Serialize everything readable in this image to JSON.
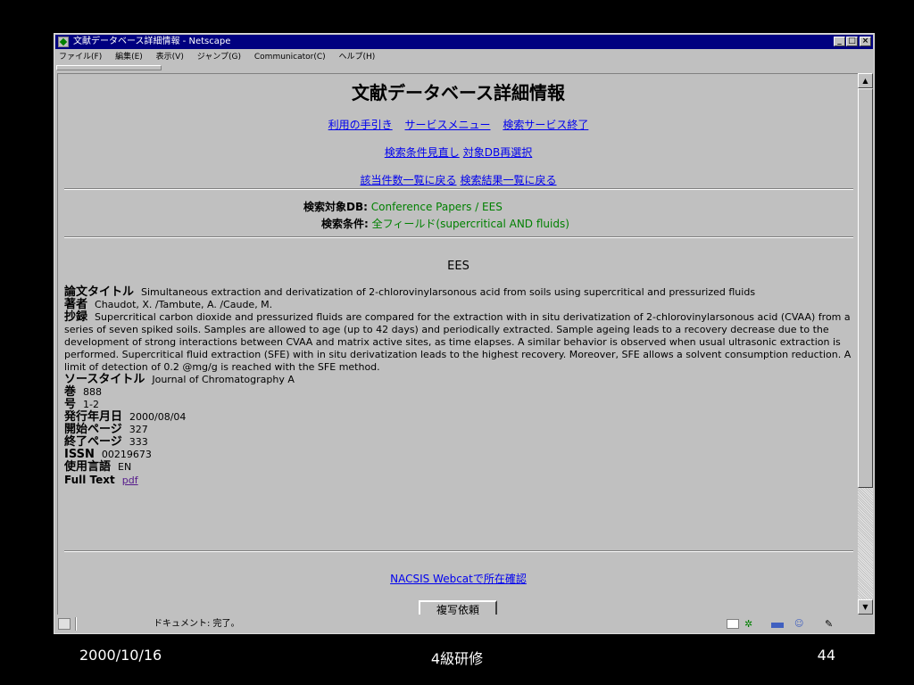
{
  "window": {
    "title": "文献データベース詳細情報 - Netscape",
    "menu": [
      "ファイル(F)",
      "編集(E)",
      "表示(V)",
      "ジャンプ(G)",
      "Communicator(C)",
      "ヘルプ(H)"
    ]
  },
  "page": {
    "title": "文献データベース詳細情報",
    "nav_row1": [
      "利用の手引き",
      "サービスメニュー",
      "検索サービス終了"
    ],
    "nav_row2": [
      "検索条件見直し",
      "対象DB再選択"
    ],
    "nav_row3": [
      "該当件数一覧に戻る",
      "検索結果一覧に戻る"
    ],
    "search": {
      "db_label": "検索対象DB:",
      "db_value": "Conference Papers / EES",
      "cond_label": "検索条件:",
      "cond_value": "全フィールド(supercritical AND fluids)"
    },
    "db_header": "EES",
    "record": {
      "title_label": "論文タイトル",
      "title_value": "Simultaneous extraction and derivatization of 2-chlorovinylarsonous acid from soils using supercritical and pressurized fluids",
      "author_label": "著者",
      "author_value": "Chaudot, X. /Tambute, A. /Caude, M.",
      "abstract_label": "抄録",
      "abstract_value": "Supercritical carbon dioxide and pressurized fluids are compared for the extraction with in situ derivatization of 2-chlorovinylarsonous acid (CVAA) from a series of seven spiked soils. Samples are allowed to age (up to 42 days) and periodically extracted. Sample ageing leads to a recovery decrease due to the development of strong interactions between CVAA and matrix active sites, as time elapses. A similar behavior is observed when usual ultrasonic extraction is performed. Supercritical fluid extraction (SFE) with in situ derivatization leads to the highest recovery. Moreover, SFE allows a solvent consumption reduction. A limit of detection of 0.2 @mg/g is reached with the SFE method.",
      "source_label": "ソースタイトル",
      "source_value": "Journal of Chromatography A",
      "volume_label": "巻",
      "volume_value": "888",
      "issue_label": "号",
      "issue_value": "1-2",
      "date_label": "発行年月日",
      "date_value": "2000/08/04",
      "start_label": "開始ページ",
      "start_value": "327",
      "end_label": "終了ページ",
      "end_value": "333",
      "issn_label": "ISSN",
      "issn_value": "00219673",
      "lang_label": "使用言語",
      "lang_value": "EN",
      "fulltext_label": "Full Text",
      "fulltext_link": "pdf"
    },
    "webcat_link": "NACSIS Webcatで所在確認",
    "copy_button": "複写依頼"
  },
  "statusbar": {
    "text": "ドキュメント: 完了。"
  },
  "footer": {
    "date": "2000/10/16",
    "center": "4級研修",
    "page": "44"
  }
}
